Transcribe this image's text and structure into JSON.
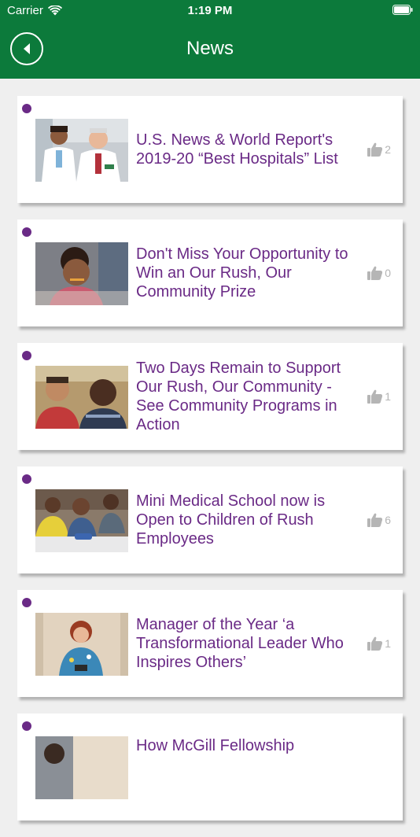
{
  "status_bar": {
    "carrier": "Carrier",
    "time": "1:19 PM"
  },
  "nav": {
    "title": "News",
    "back_icon": "back-arrow-icon"
  },
  "colors": {
    "header": "#0c7a3b",
    "title_text": "#6a2a86",
    "unread_dot": "#6a2a86",
    "likes": "#b5b5b5"
  },
  "news": [
    {
      "title": "U.S. News & World Report's 2019-20 “Best Hospitals” List",
      "likes": "2",
      "image": "doctors-photo"
    },
    {
      "title": "Don't Miss Your Opportunity to Win an Our Rush, Our Community Prize",
      "likes": "0",
      "image": "child-photo"
    },
    {
      "title": "Two Days Remain to Support Our Rush, Our Community - See Community Programs in Action",
      "likes": "1",
      "image": "children-photo"
    },
    {
      "title": "Mini Medical School now is Open to Children of Rush Employees",
      "likes": "6",
      "image": "classroom-photo"
    },
    {
      "title": "Manager of the Year ‘a Transformational Leader Who Inspires Others’",
      "likes": "1",
      "image": "manager-photo"
    },
    {
      "title": "How McGill Fellowship",
      "likes": "",
      "image": "person-photo"
    }
  ]
}
